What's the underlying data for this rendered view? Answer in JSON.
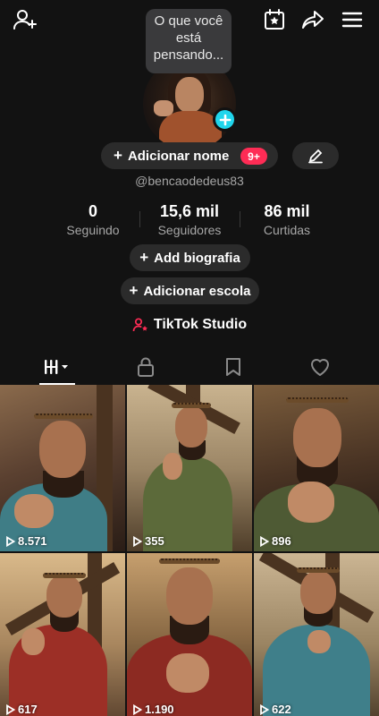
{
  "header": {
    "add_friend_icon": "person-plus-icon",
    "calendar_icon": "calendar-star-icon",
    "share_icon": "share-arrow-icon",
    "menu_icon": "hamburger-menu-icon"
  },
  "thought_bubble": {
    "text": "O que você está pensando..."
  },
  "profile": {
    "add_name_label": "Adicionar nome",
    "notification_badge": "9+",
    "username": "@bencaodedeus83",
    "stats": [
      {
        "value": "0",
        "label": "Seguindo"
      },
      {
        "value": "15,6 mil",
        "label": "Seguidores"
      },
      {
        "value": "86 mil",
        "label": "Curtidas"
      }
    ],
    "add_bio_label": "Add biografia",
    "add_school_label": "Adicionar escola",
    "studio_label": "TikTok Studio"
  },
  "tabs": [
    {
      "name": "videos",
      "icon": "grid-bars-icon",
      "selected": true
    },
    {
      "name": "private",
      "icon": "lock-icon"
    },
    {
      "name": "favorites",
      "icon": "bookmark-icon"
    },
    {
      "name": "liked",
      "icon": "heart-icon"
    }
  ],
  "videos": [
    {
      "views": "8.571"
    },
    {
      "views": "355"
    },
    {
      "views": "896"
    },
    {
      "views": "617"
    },
    {
      "views": "1.190"
    },
    {
      "views": "622"
    }
  ],
  "colors": {
    "background": "#121212",
    "accent_pink": "#fe2c55",
    "accent_cyan": "#20d5ec",
    "pill_bg": "#2b2b2b",
    "muted_text": "#a6a6a6"
  }
}
